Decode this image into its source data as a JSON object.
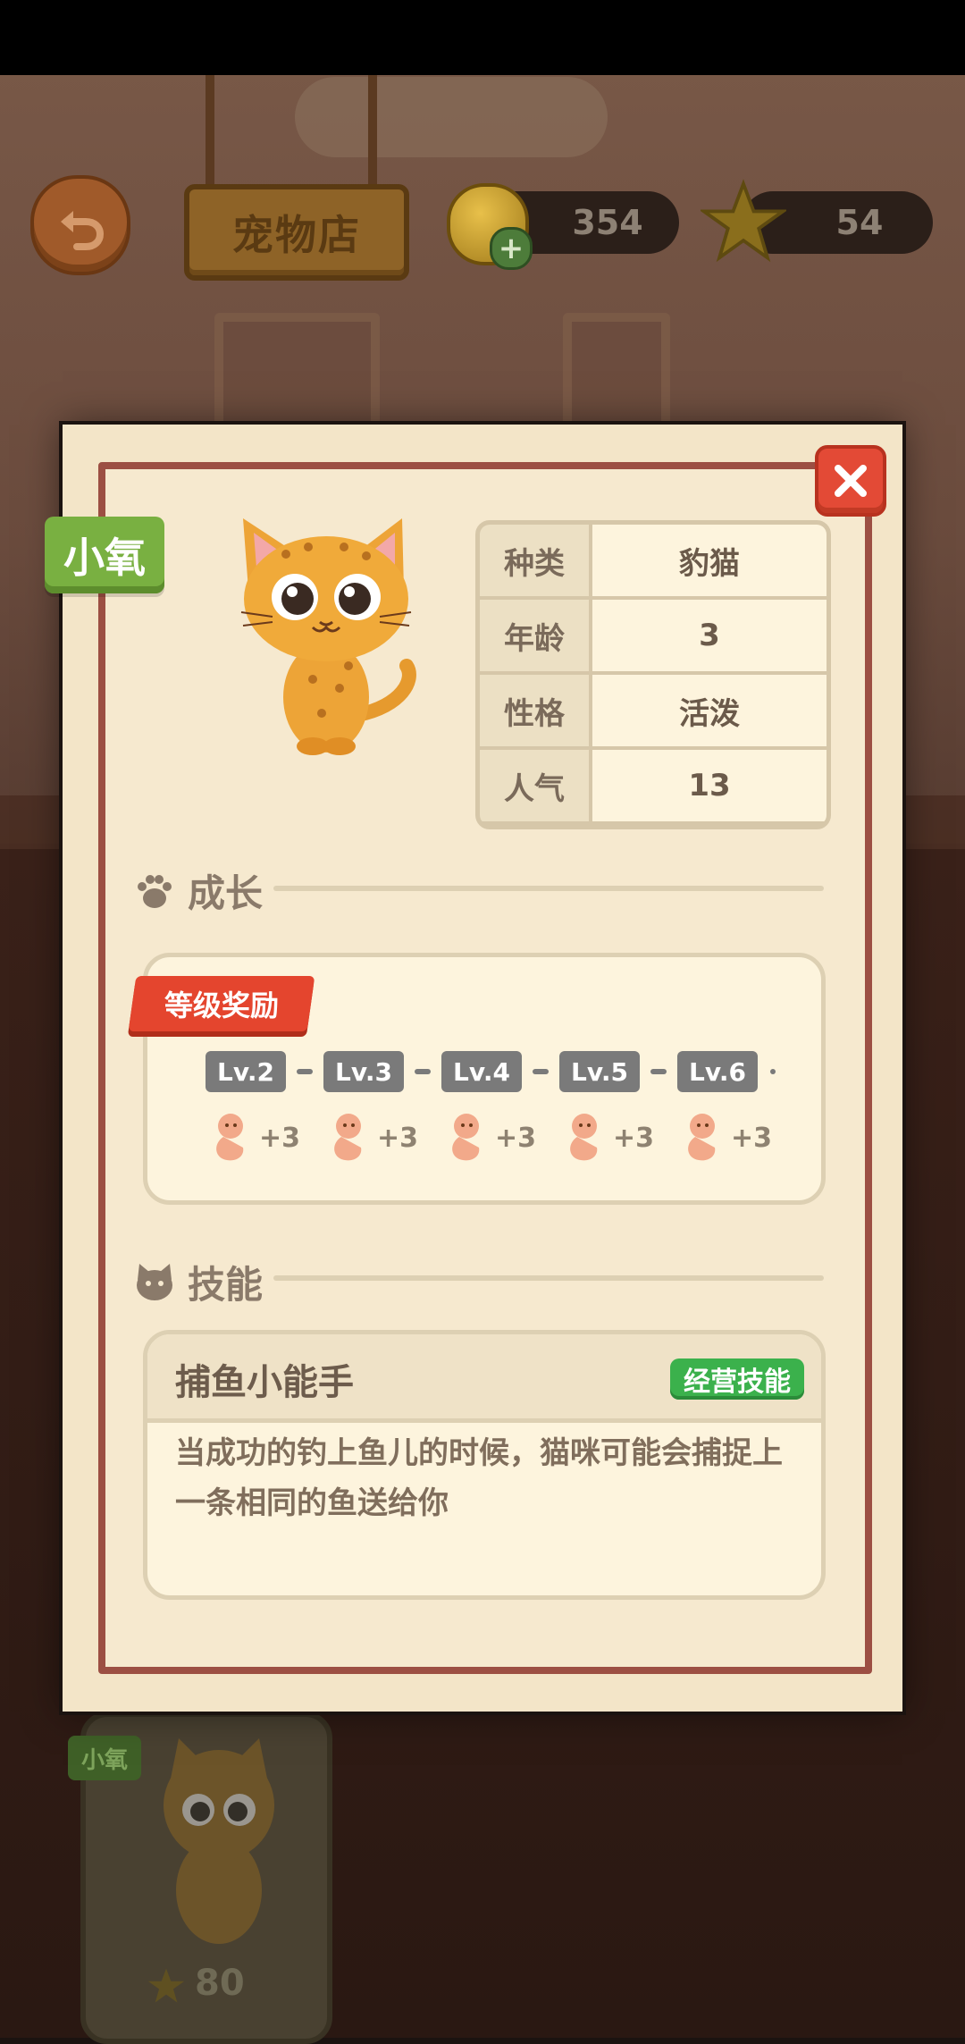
{
  "hud": {
    "shop_title": "宠物店",
    "coins": "354",
    "stars": "54"
  },
  "background_card": {
    "name": "小氧",
    "stars": "80"
  },
  "pet": {
    "name": "小氧",
    "info": [
      {
        "key": "种类",
        "value": "豹猫"
      },
      {
        "key": "年龄",
        "value": "3"
      },
      {
        "key": "性格",
        "value": "活泼"
      },
      {
        "key": "人气",
        "value": "13"
      }
    ]
  },
  "growth": {
    "title": "成长",
    "reward_label": "等级奖励",
    "levels": [
      "Lv.2",
      "Lv.3",
      "Lv.4",
      "Lv.5",
      "Lv.6"
    ],
    "rewards": [
      "+3",
      "+3",
      "+3",
      "+3",
      "+3"
    ]
  },
  "skills": {
    "title": "技能",
    "name": "捕鱼小能手",
    "tag": "经营技能",
    "description": "当成功的钓上鱼儿的时候，猫咪可能会捕捉上一条相同的鱼送给你"
  },
  "icons": {
    "back": "back-arrow-icon",
    "close": "close-icon",
    "coin": "coin-bucket-icon",
    "star": "star-icon",
    "paw": "paw-icon",
    "cat_head": "cat-head-icon",
    "worm": "worm-icon"
  },
  "colors": {
    "close_red": "#e34a36",
    "name_green": "#79b041",
    "skill_tag_green": "#3bb14c",
    "ribbon_red": "#e4452e",
    "border_brown": "#9c4f43"
  }
}
